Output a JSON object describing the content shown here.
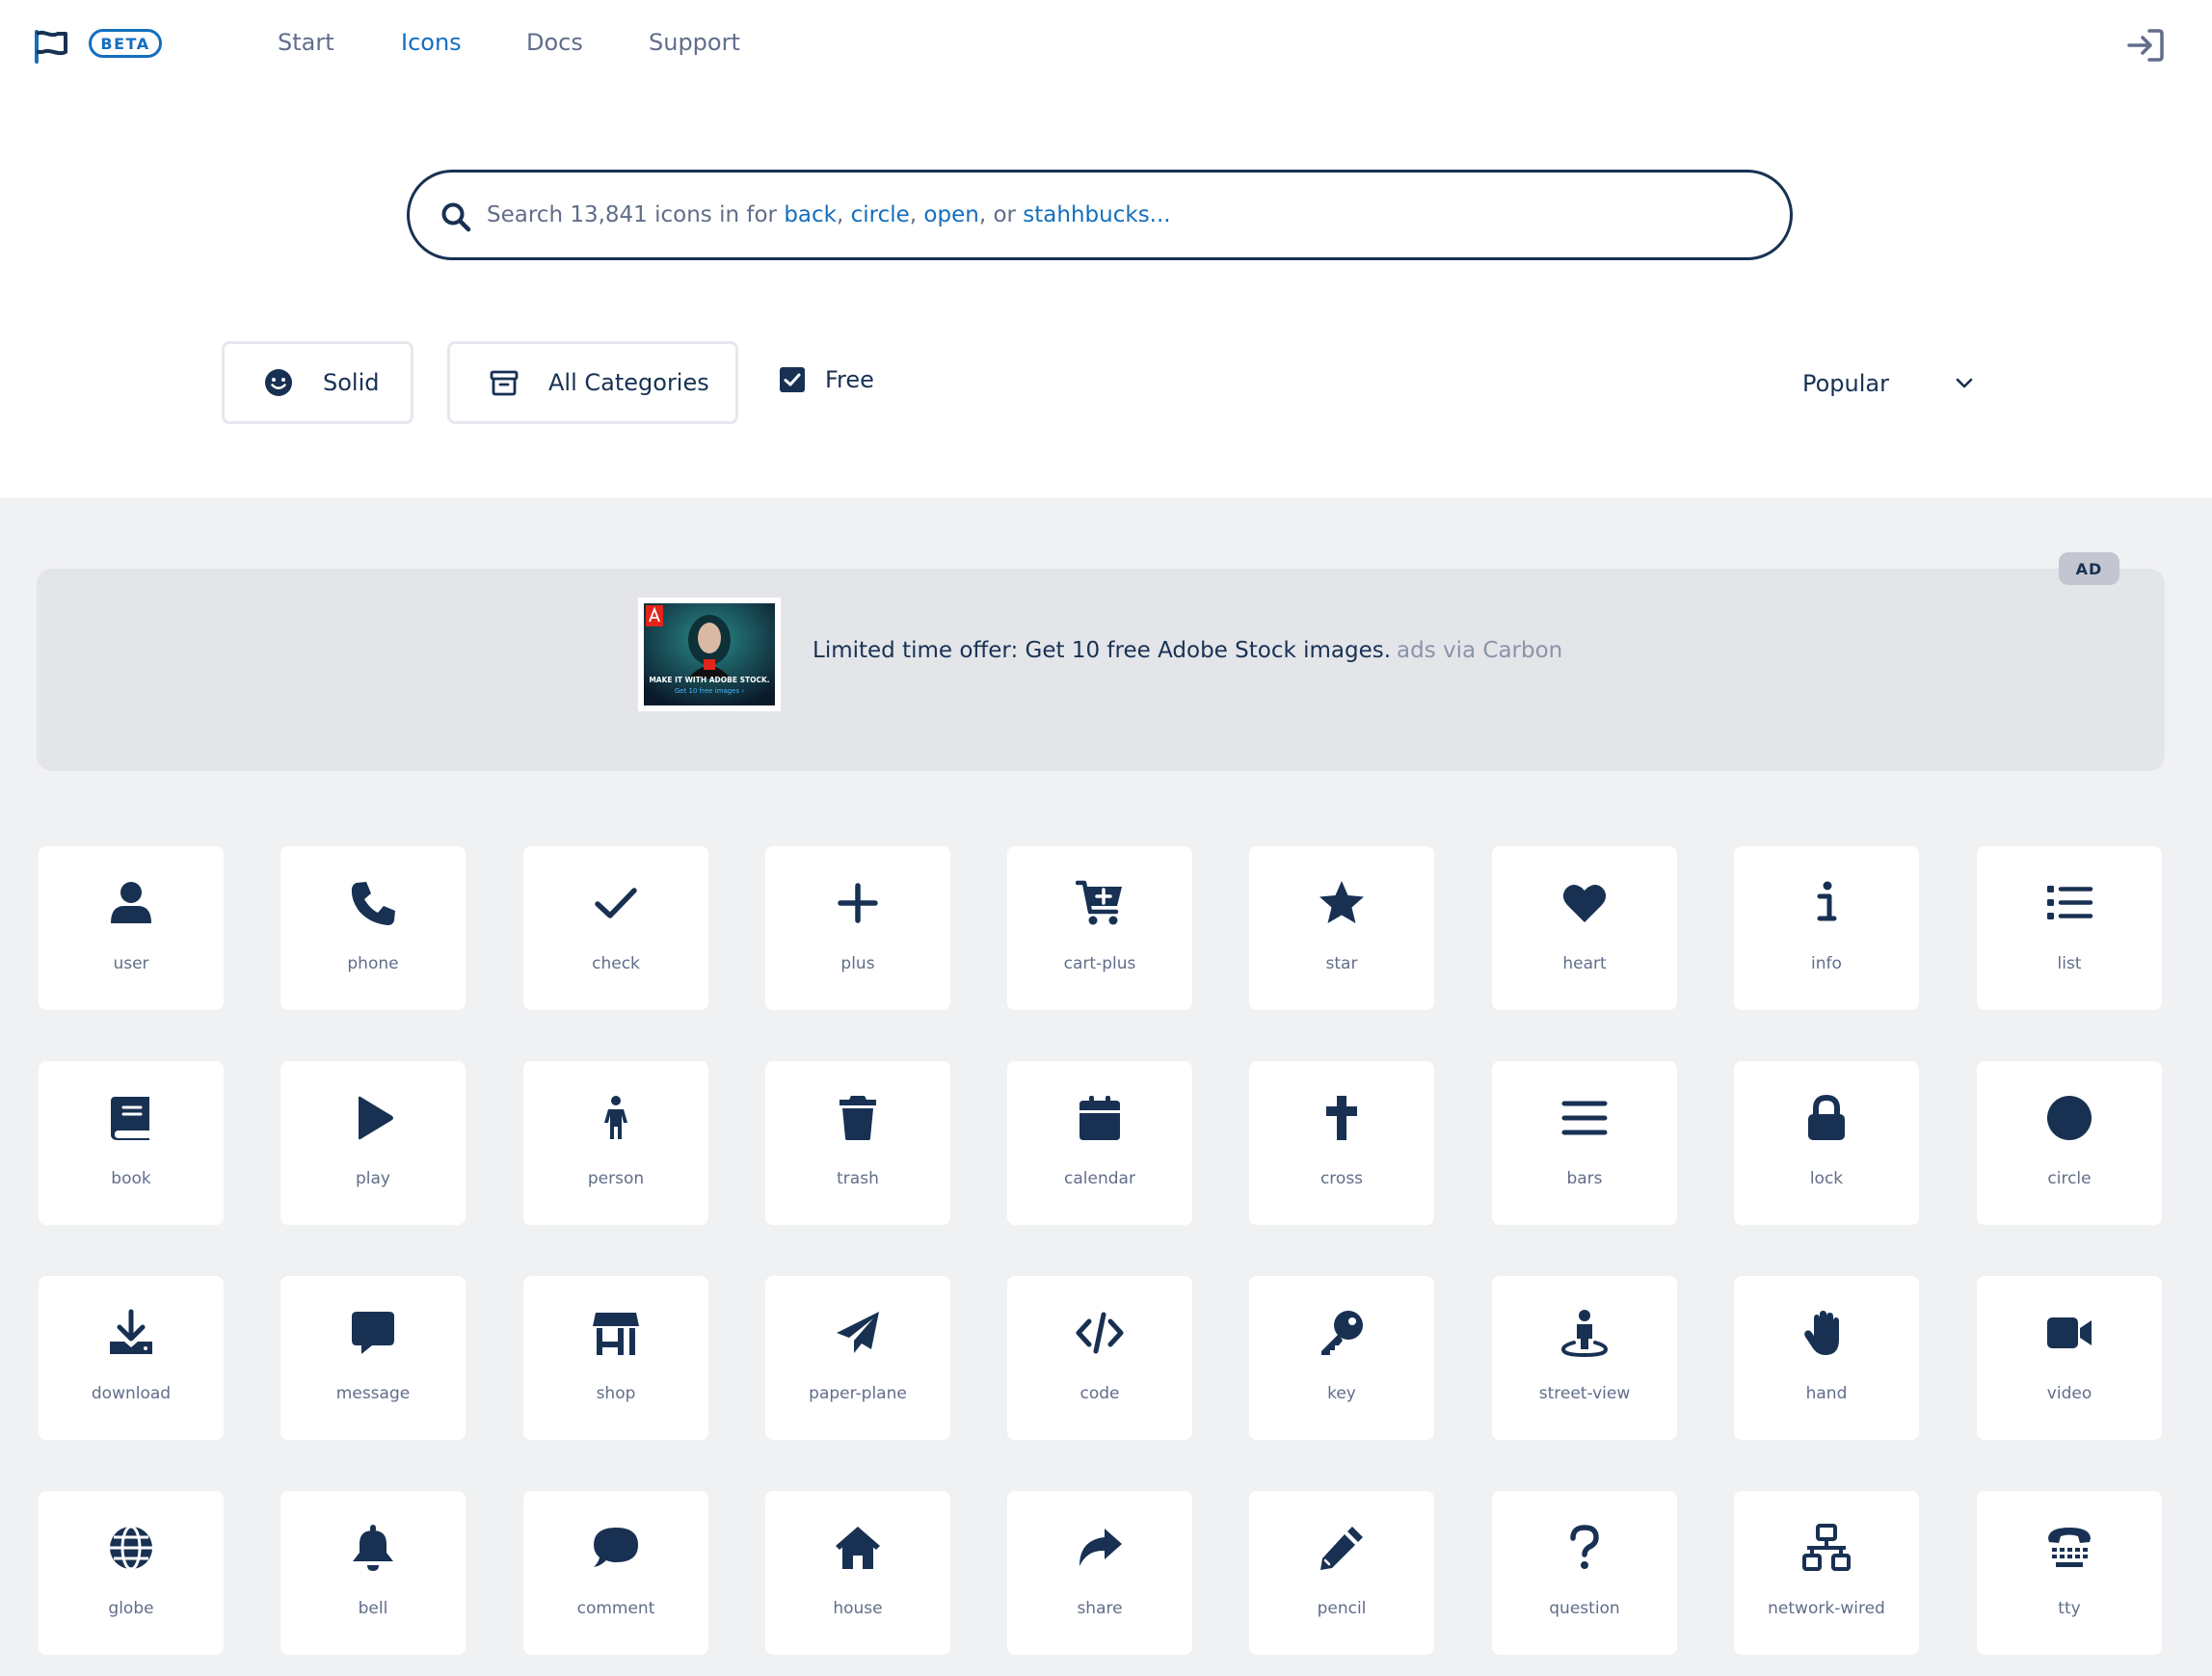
{
  "nav": {
    "beta_badge": "BETA",
    "links": [
      "Start",
      "Icons",
      "Docs",
      "Support"
    ],
    "active_link": "Icons",
    "logo_icon": "flag-icon",
    "signin_icon": "sign-in-icon"
  },
  "search": {
    "prefix": "Search 13,841 icons in for",
    "keyword_1": "back",
    "sep_1": ",",
    "keyword_2": "circle",
    "sep_2": ",",
    "keyword_3": "open",
    "sep_3": ", or",
    "keyword_4": "stahhbucks...",
    "icon": "search-icon"
  },
  "filters": {
    "style_label": "Solid",
    "category_label": "All Categories",
    "free_label": "Free",
    "free_checked": true,
    "sort_label": "Popular"
  },
  "ad": {
    "tag": "AD",
    "text": "Limited time offer: Get 10 free Adobe Stock images.",
    "via": "ads via Carbon",
    "image_caption_1": "MAKE IT WITH ADOBE STOCK.",
    "image_caption_2": "Get 10 free images ›"
  },
  "icons": [
    "user",
    "phone",
    "check",
    "plus",
    "cart-plus",
    "star",
    "heart",
    "info",
    "list",
    "book",
    "play",
    "person",
    "trash",
    "calendar",
    "cross",
    "bars",
    "lock",
    "circle",
    "download",
    "message",
    "shop",
    "paper-plane",
    "code",
    "key",
    "street-view",
    "hand",
    "video",
    "globe",
    "bell",
    "comment",
    "house",
    "share",
    "pencil",
    "question",
    "network-wired",
    "tty"
  ],
  "colors": {
    "navy": "#183153",
    "accent_blue": "#146ebe",
    "muted_text": "#616d8a",
    "gray_background": "#f0f1f3",
    "ad_background": "#e3e5e9"
  }
}
